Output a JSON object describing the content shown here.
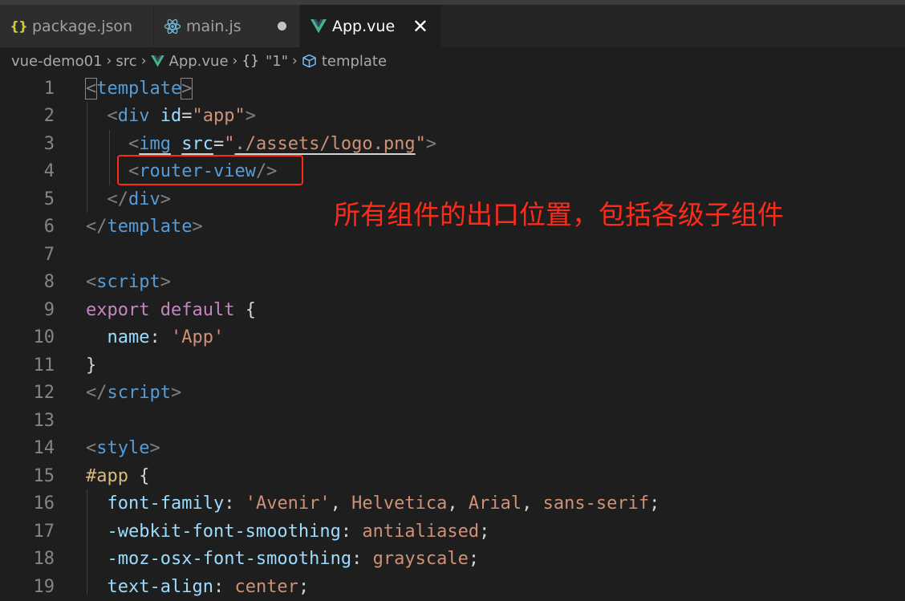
{
  "tabs": [
    {
      "label": "package.json",
      "icon": "json-braces-icon",
      "state": "inactive"
    },
    {
      "label": "main.js",
      "icon": "react-atom-icon",
      "state": "inactive-modified"
    },
    {
      "label": "App.vue",
      "icon": "vue-logo-icon",
      "state": "active"
    }
  ],
  "close_glyph": "✕",
  "breadcrumb": {
    "items": [
      "vue-demo01",
      "src",
      "App.vue",
      "\"1\"",
      "template"
    ],
    "braces_glyph": "{}",
    "separator": "›"
  },
  "line_numbers": [
    "1",
    "2",
    "3",
    "4",
    "5",
    "6",
    "7",
    "8",
    "9",
    "10",
    "11",
    "12",
    "13",
    "14",
    "15",
    "16",
    "17",
    "18",
    "19"
  ],
  "code": {
    "l1": {
      "open": "<",
      "tag": "template",
      "close": ">"
    },
    "l2": {
      "open": "<",
      "tag": "div",
      "attr": "id",
      "eq": "=",
      "val": "\"app\"",
      "close": ">"
    },
    "l3": {
      "open": "<",
      "tag": "img",
      "attr": "src",
      "eq": "=",
      "q1": "\"",
      "val": "./assets/logo.png",
      "q2": "\"",
      "close": ">"
    },
    "l4": {
      "open": "<",
      "tag": "router-view",
      "close": "/>"
    },
    "l5": {
      "open": "</",
      "tag": "div",
      "close": ">"
    },
    "l6": {
      "open": "</",
      "tag": "template",
      "close": ">"
    },
    "l8": {
      "open": "<",
      "tag": "script",
      "close": ">"
    },
    "l9": {
      "kw1": "export",
      "kw2": "default",
      "brace": "{"
    },
    "l10": {
      "key": "name",
      "colon": ":",
      "val": "'App'"
    },
    "l11": {
      "brace": "}"
    },
    "l12": {
      "open": "</",
      "tag": "script",
      "close": ">"
    },
    "l14": {
      "open": "<",
      "tag": "style",
      "close": ">"
    },
    "l15": {
      "sel": "#app",
      "brace": "{"
    },
    "l16": {
      "prop": "font-family",
      "colon": ":",
      "v1": "'Avenir'",
      "c1": ",",
      "v2": "Helvetica",
      "c2": ",",
      "v3": "Arial",
      "c3": ",",
      "v4": "sans-serif",
      "semi": ";"
    },
    "l17": {
      "prop": "-webkit-font-smoothing",
      "colon": ":",
      "val": "antialiased",
      "semi": ";"
    },
    "l18": {
      "prop": "-moz-osx-font-smoothing",
      "colon": ":",
      "val": "grayscale",
      "semi": ";"
    },
    "l19": {
      "prop": "text-align",
      "colon": ":",
      "val": "center",
      "semi": ";"
    }
  },
  "annotation": "所有组件的出口位置，包括各级子组件",
  "colors": {
    "editor_bg": "#1e1e1e",
    "tab_inactive_bg": "#2d2d2d",
    "tag": "#569cd6",
    "attr": "#9cdcfe",
    "string": "#ce9178",
    "keyword": "#c586c0",
    "selector": "#d7ba7d",
    "annotation": "#ff2a1a"
  }
}
